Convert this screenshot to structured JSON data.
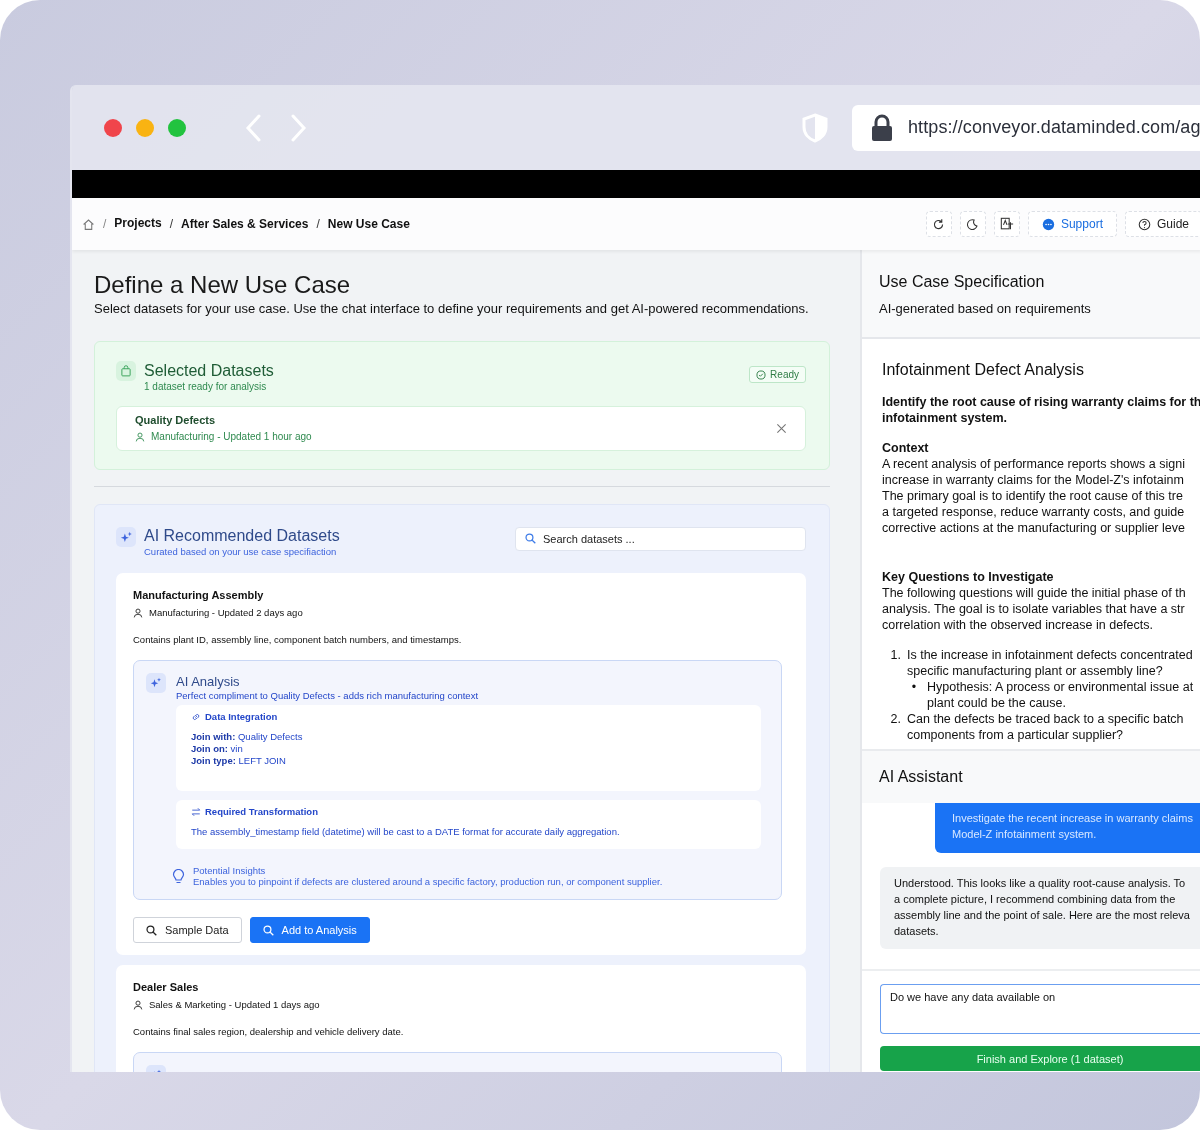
{
  "browser": {
    "url": "https://conveyor.dataminded.com/ag"
  },
  "header": {
    "separator": "/",
    "breadcrumbs": [
      "Projects",
      "After Sales & Services",
      "New Use Case"
    ],
    "buttons": [
      {
        "label": "Support",
        "kind": "primary"
      },
      {
        "label": "Guide",
        "kind": "plain"
      }
    ]
  },
  "page": {
    "title": "Define a New Use Case",
    "subtitle": "Select datasets for your use case. Use the chat interface to define your requirements and get AI-powered recommendations."
  },
  "selected": {
    "title": "Selected Datasets",
    "subtitle": "1 dataset ready for analysis",
    "status": "Ready",
    "datasets": [
      {
        "name": "Quality Defects",
        "meta": "Manufacturing - Updated 1 hour ago"
      }
    ]
  },
  "recommended": {
    "title": "AI Recommended Datasets",
    "subtitle": "Curated based on your use case specifiaction",
    "search_placeholder": "Search datasets ...",
    "datasets": [
      {
        "name": "Manufacturing Assembly",
        "meta": "Manufacturing - Updated 2 days ago",
        "description": "Contains plant ID, assembly line, component batch numbers, and timestamps.",
        "analysis": {
          "title": "AI Analysis",
          "summary": "Perfect compliment to Quality Defects - adds rich manufacturing context",
          "integration": {
            "title": "Data Integration",
            "rows": [
              {
                "label": "Join with:",
                "value": "Quality Defects"
              },
              {
                "label": "Join on:",
                "value": "vin"
              },
              {
                "label": "Join type:",
                "value": "LEFT JOIN"
              }
            ]
          },
          "transformation": {
            "title": "Required Transformation",
            "text": "The assembly_timestamp field (datetime) will be cast to a DATE format for accurate daily aggregation."
          },
          "insights": {
            "title": "Potential Insights",
            "text": "Enables you to pinpoint if defects are clustered around a specific factory, production run, or component supplier."
          }
        },
        "buttons": [
          {
            "label": "Sample Data",
            "kind": "secondary"
          },
          {
            "label": "Add to Analysis",
            "kind": "primary"
          }
        ]
      },
      {
        "name": "Dealer Sales",
        "meta": "Sales & Marketing - Updated 1 days ago",
        "description": "Contains final sales region, dealership and vehicle delivery date."
      }
    ]
  },
  "spec": {
    "title": "Use Case Specification",
    "subtitle": "AI-generated based on requirements",
    "heading": "Infotainment Defect Analysis",
    "intro": [
      "Identify the root cause of rising warranty claims for th",
      "infotainment system."
    ],
    "sections": [
      {
        "heading": "Context",
        "lines": [
          "A recent analysis of performance reports shows a signi",
          "increase in warranty claims for the Model-Z's infotainm",
          "The primary goal is to identify the root cause of this tre",
          "a targeted response, reduce warranty costs, and guide",
          "corrective actions at the manufacturing or supplier leve"
        ]
      },
      {
        "heading": "Key Questions to Investigate",
        "lines": [
          "The following questions will guide the initial phase of th",
          "analysis. The goal is to isolate variables that have a str",
          "correlation with the observed increase in defects."
        ]
      }
    ],
    "questions": [
      {
        "number": "1.",
        "lines": [
          "Is the increase in infotainment defects concentrated",
          "specific manufacturing plant or assembly line?"
        ],
        "bullets": [
          {
            "mark": "•",
            "lines": [
              "Hypothesis: A process or environmental issue at",
              "plant could be the cause."
            ]
          }
        ]
      },
      {
        "number": "2.",
        "lines": [
          "Can the defects be traced back to a specific batch",
          "components from a particular supplier?"
        ]
      }
    ]
  },
  "assistant": {
    "title": "AI Assistant",
    "messages": [
      {
        "kind": "user",
        "lines": [
          "Investigate the recent increase in warranty claims",
          "Model-Z infotainment system."
        ]
      },
      {
        "kind": "assistant",
        "lines": [
          "Understood. This looks like a quality root-cause analysis. To",
          "a complete picture, I recommend combining data from the",
          "assembly line and the point of sale. Here are the most releva",
          "datasets."
        ]
      }
    ],
    "input_value": "Do we have any data available on",
    "finish_button": "Finish and Explore (1 dataset)"
  }
}
